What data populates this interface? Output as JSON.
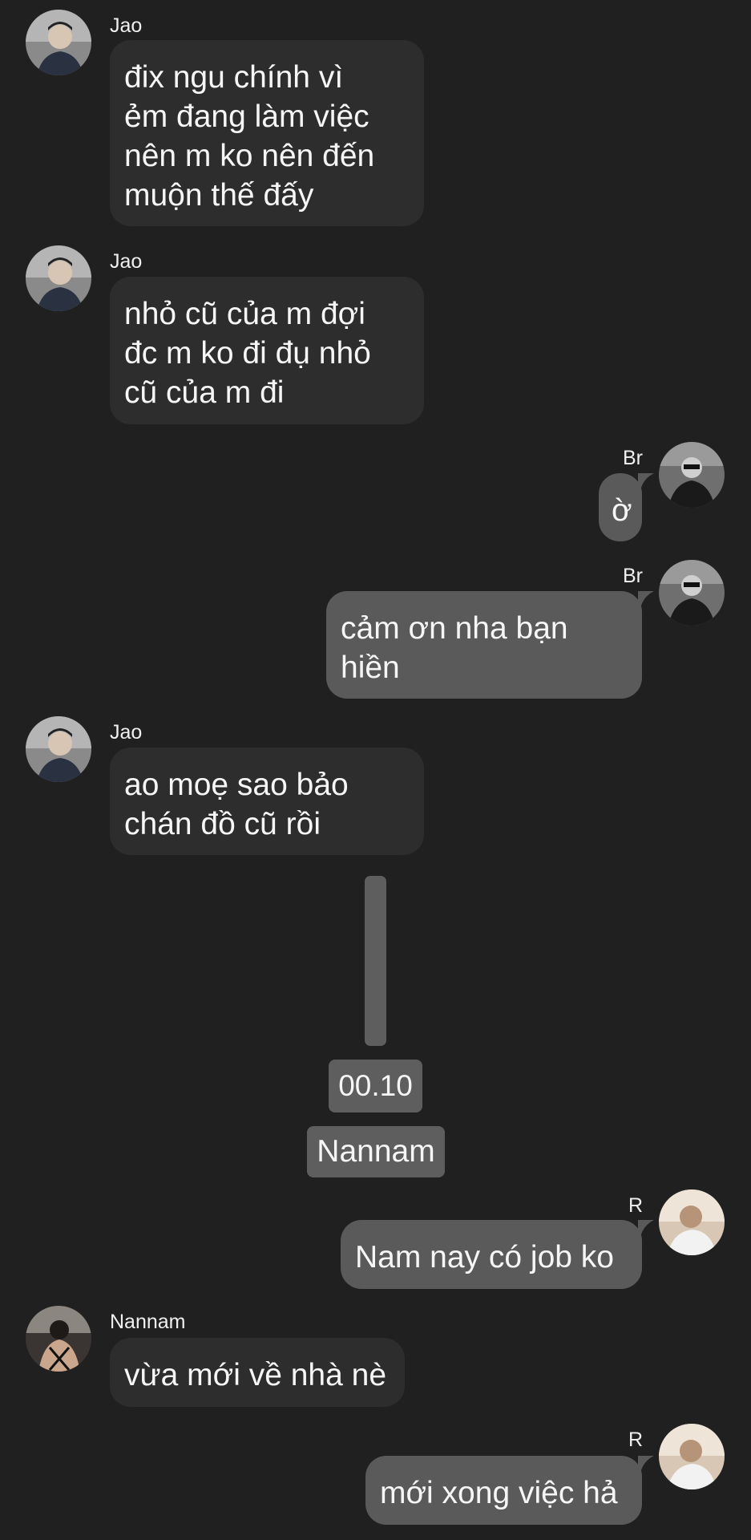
{
  "messages": [
    {
      "sender": "Jao",
      "text": "đix ngu chính vì\nẻm đang làm việc\nnên m ko nên đến\nmuộn thế đấy"
    },
    {
      "sender": "Jao",
      "text": "nhỏ cũ của m đợi\nđc m ko đi đụ nhỏ\ncũ của m đi"
    },
    {
      "sender": "Br",
      "text": "ờ"
    },
    {
      "sender": "Br",
      "text": "cảm ơn nha bạn\nhiền"
    },
    {
      "sender": "Jao",
      "text": "ao moẹ sao bảo\nchán đồ cũ rồi"
    },
    {
      "sender": "R",
      "text": "Nam nay có job ko"
    },
    {
      "sender": "Nannam",
      "text": "vừa mới về nhà nè"
    },
    {
      "sender": "R",
      "text": "mới xong việc hả"
    }
  ],
  "labels": {
    "time": "00.10",
    "name": "Nannam"
  },
  "colors": {
    "background": "#202020",
    "incoming_bubble": "#2d2d2d",
    "outgoing_bubble": "#5a5a5a",
    "label_box": "#5e5e5e"
  }
}
